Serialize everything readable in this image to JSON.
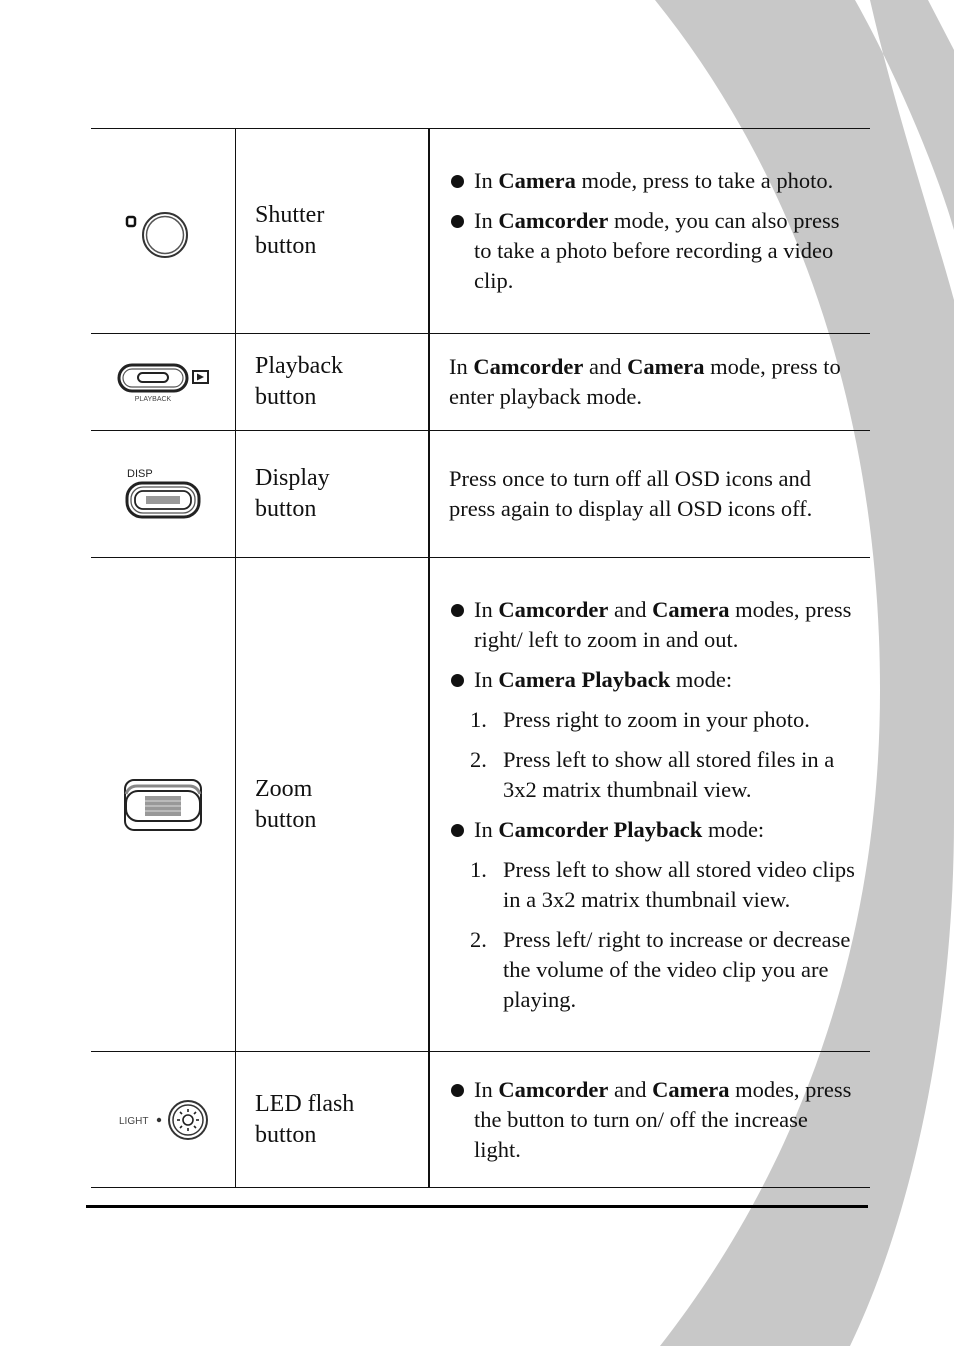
{
  "background": {
    "arc_color": "#c8c8c8"
  },
  "rows": [
    {
      "icon": "shutter-button-icon",
      "name_line1": "Shutter",
      "name_line2": "button",
      "bullets": [
        {
          "pre": "In ",
          "bold1": "Camera",
          "post": " mode, press to take a photo."
        },
        {
          "pre": "In ",
          "bold1": "Camcorder",
          "post": " mode, you can also press to take a photo before recording a video clip."
        }
      ]
    },
    {
      "icon": "playback-button-icon",
      "icon_caption": "PLAYBACK",
      "name_line1": "Playback",
      "name_line2": "button",
      "para": {
        "pre": "In ",
        "bold1": "Camcorder",
        "mid": " and ",
        "bold2": "Camera",
        "post": " mode, press to enter playback mode."
      }
    },
    {
      "icon": "display-button-icon",
      "icon_caption": "DISP",
      "name_line1": "Display",
      "name_line2": "button",
      "para_text": "Press once to turn off all OSD icons and press again to display all OSD icons off."
    },
    {
      "icon": "zoom-button-icon",
      "name_line1": "Zoom",
      "name_line2": "button",
      "b1": {
        "pre": "In ",
        "bold1": "Camcorder",
        "mid": " and ",
        "bold2": "Camera",
        "post": " modes, press right/ left to zoom in and out."
      },
      "b2": {
        "pre": "In ",
        "bold1": "Camera Playback",
        "post": " mode:"
      },
      "b2_items": [
        {
          "n": "1.",
          "text": "Press right to zoom in your photo."
        },
        {
          "n": "2.",
          "text": "Press left to show all stored files in a 3x2 matrix thumbnail view."
        }
      ],
      "b3": {
        "pre": "In ",
        "bold1": "Camcorder Playback",
        "post": " mode:"
      },
      "b3_items": [
        {
          "n": "1.",
          "text": "Press left to show all stored video clips in a 3x2 matrix thumbnail view."
        },
        {
          "n": "2.",
          "text": "Press left/ right to increase or decrease the volume of the video clip you are playing."
        }
      ]
    },
    {
      "icon": "led-flash-button-icon",
      "icon_caption": "LIGHT",
      "name_line1": "LED flash",
      "name_line2": "button",
      "b1": {
        "pre": "In ",
        "bold1": "Camcorder",
        "mid": " and ",
        "bold2": "Camera",
        "post": " modes, press the button to turn on/ off the increase light."
      }
    }
  ]
}
